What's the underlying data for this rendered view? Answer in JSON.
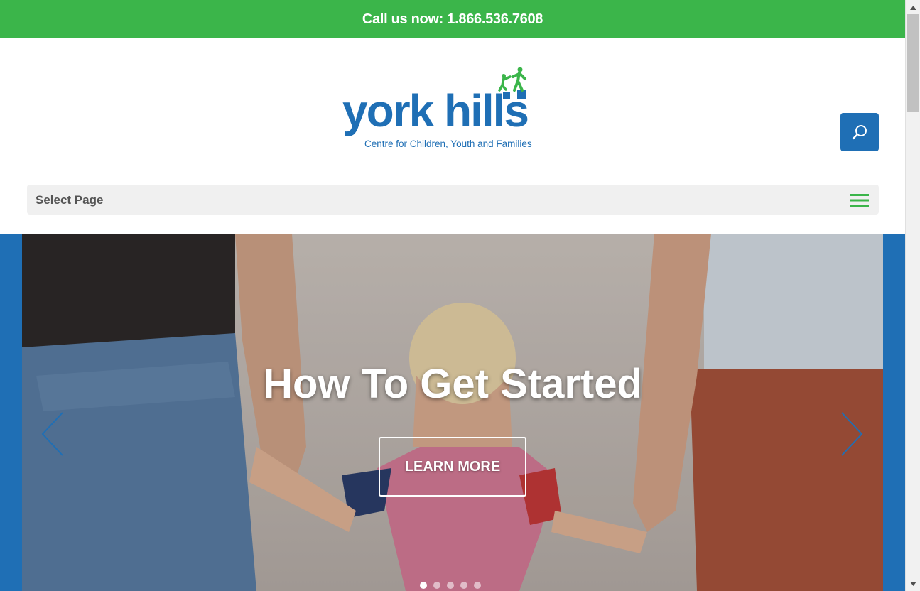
{
  "topbar": {
    "call_text": "Call us now: 1.866.536.7608"
  },
  "logo": {
    "wordmark": "york hills",
    "tagline": "Centre for Children, Youth and Families",
    "colors": {
      "blue": "#1f6fb5",
      "green": "#3bb54a"
    }
  },
  "search": {
    "icon": "search-icon"
  },
  "menu": {
    "label": "Select Page",
    "icon": "hamburger-icon"
  },
  "hero": {
    "title": "How To Get Started",
    "button": "LEARN MORE",
    "slides_count": 5,
    "active_slide": 1,
    "prev_icon": "chevron-left-icon",
    "next_icon": "chevron-right-icon"
  },
  "colors": {
    "accent_green": "#3bb54a",
    "brand_blue": "#1f6fb5",
    "menu_bg": "#f0f0f0"
  }
}
